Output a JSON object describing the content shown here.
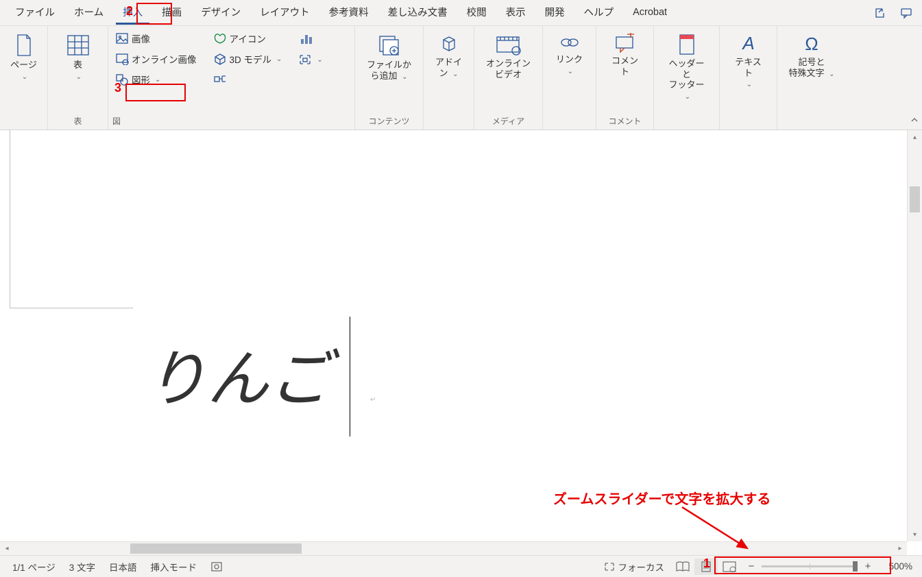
{
  "tabs": {
    "items": [
      "ファイル",
      "ホーム",
      "挿入",
      "描画",
      "デザイン",
      "レイアウト",
      "参考資料",
      "差し込み文書",
      "校閲",
      "表示",
      "開発",
      "ヘルプ",
      "Acrobat"
    ],
    "active_index": 2
  },
  "ribbon": {
    "pages": {
      "label": "ページ",
      "group": ""
    },
    "table": {
      "label": "表",
      "group": "表"
    },
    "illustrations": {
      "image": "画像",
      "online_image": "オンライン画像",
      "shapes": "図形",
      "icons": "アイコン",
      "models_3d": "3D モデル",
      "smartart": "",
      "chart": "",
      "screenshot": "",
      "group": "図"
    },
    "reuse": {
      "l1": "ファイルか",
      "l2": "ら追加",
      "group": "コンテンツ"
    },
    "addins": {
      "l1": "アドイ",
      "l2": "ン",
      "group": ""
    },
    "online_video": {
      "l1": "オンライン",
      "l2": "ビデオ",
      "group": "メディア"
    },
    "link": {
      "label": "リンク",
      "group": ""
    },
    "comment": {
      "label": "コメント",
      "group": "コメント"
    },
    "header_footer": {
      "l1": "ヘッダーと",
      "l2": "フッター",
      "group": ""
    },
    "text": {
      "label": "テキスト",
      "group": ""
    },
    "symbols": {
      "l1": "記号と",
      "l2": "特殊文字",
      "group": ""
    }
  },
  "document": {
    "text": "りんご"
  },
  "status": {
    "pages": "1/1 ページ",
    "words": "3 文字",
    "lang": "日本語",
    "mode": "挿入モード",
    "focus": "フォーカス",
    "zoom_pct": "500%",
    "zoom_thumb_pct": 97
  },
  "annotations": {
    "n1": "1",
    "n2": "2",
    "n3": "3",
    "text": "ズームスライダーで文字を拡大する"
  }
}
